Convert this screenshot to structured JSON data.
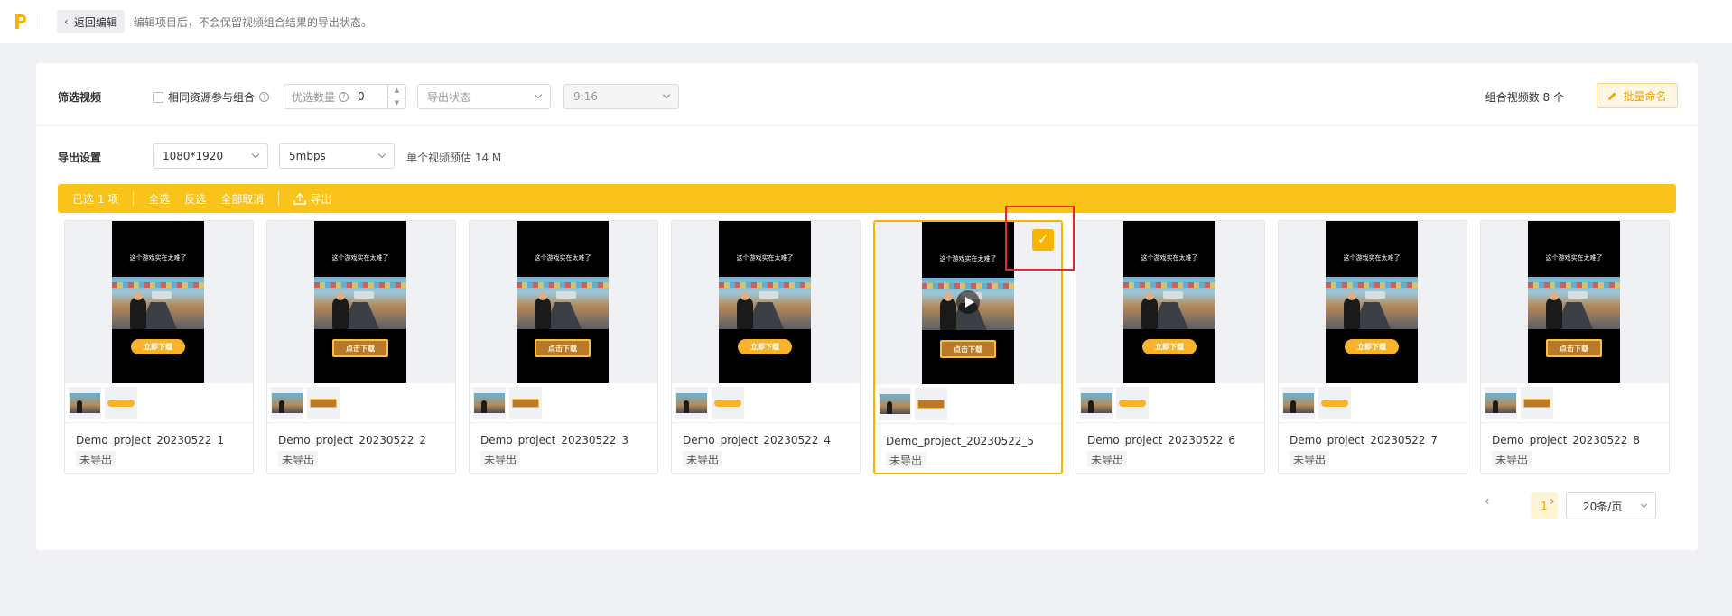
{
  "topbar": {
    "logo_icon": "app-logo-icon",
    "back_label": "返回编辑",
    "hint": "编辑项目后，不会保留视频组合结果的导出状态。"
  },
  "filter": {
    "label": "筛选视频",
    "same_source_label": "相同资源参与组合",
    "priority_placeholder": "优选数量",
    "priority_value": "0",
    "export_status_placeholder": "导出状态",
    "ratio_value": "9:16",
    "combo_count": "组合视频数 8 个",
    "rename_label": "批量命名"
  },
  "export": {
    "label": "导出设置",
    "resolution": "1080*1920",
    "bitrate": "5mbps",
    "estimate": "单个视频预估 14 M"
  },
  "toolbar": {
    "selected": "已选 1 项",
    "select_all": "全选",
    "invert": "反选",
    "cancel_all": "全部取消",
    "export": "导出"
  },
  "cards": [
    {
      "name": "Demo_project_20230522_1",
      "status": "未导出",
      "caption": "这个游戏实在太难了",
      "cta": "立即下载",
      "cta_style": "pill",
      "selected": false
    },
    {
      "name": "Demo_project_20230522_2",
      "status": "未导出",
      "caption": "这个游戏实在太难了",
      "cta": "点击下载",
      "cta_style": "box",
      "selected": false
    },
    {
      "name": "Demo_project_20230522_3",
      "status": "未导出",
      "caption": "这个游戏实在太难了",
      "cta": "点击下载",
      "cta_style": "box",
      "selected": false
    },
    {
      "name": "Demo_project_20230522_4",
      "status": "未导出",
      "caption": "这个游戏实在太难了",
      "cta": "立即下载",
      "cta_style": "pill",
      "selected": false
    },
    {
      "name": "Demo_project_20230522_5",
      "status": "未导出",
      "caption": "这个游戏实在太难了",
      "cta": "点击下载",
      "cta_style": "box",
      "selected": true
    },
    {
      "name": "Demo_project_20230522_6",
      "status": "未导出",
      "caption": "这个游戏实在太难了",
      "cta": "立即下载",
      "cta_style": "pill",
      "selected": false
    },
    {
      "name": "Demo_project_20230522_7",
      "status": "未导出",
      "caption": "这个游戏实在太难了",
      "cta": "立即下载",
      "cta_style": "pill",
      "selected": false
    },
    {
      "name": "Demo_project_20230522_8",
      "status": "未导出",
      "caption": "这个游戏实在太难了",
      "cta": "点击下载",
      "cta_style": "box",
      "selected": false
    }
  ],
  "pagination": {
    "current": "1",
    "page_size": "20条/页"
  },
  "colors": {
    "accent": "#fac319",
    "selected_border": "#f7b500",
    "highlight": "#e8262b"
  }
}
